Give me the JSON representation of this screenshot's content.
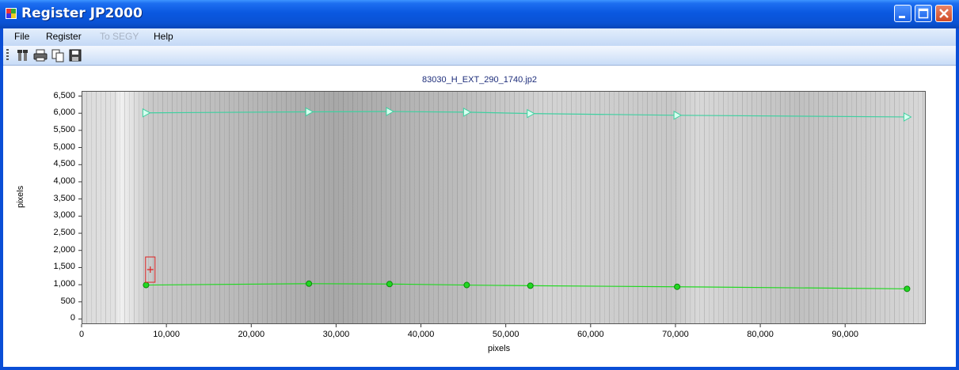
{
  "window": {
    "title": "Register JP2000",
    "buttons": [
      "minimize",
      "maximize",
      "close"
    ]
  },
  "menu": {
    "items": [
      {
        "label": "File",
        "enabled": true
      },
      {
        "label": "Register",
        "enabled": true
      },
      {
        "label": "To SEGY",
        "enabled": false
      },
      {
        "label": "Help",
        "enabled": true
      }
    ]
  },
  "toolbar": {
    "tools": [
      "settings-icon",
      "print-icon",
      "copy-icon",
      "save-icon"
    ]
  },
  "chart_data": {
    "type": "scatter",
    "title": "83030_H_EXT_290_1740.jp2",
    "xlabel": "pixels",
    "ylabel": "pixels",
    "xlim": [
      0,
      99500
    ],
    "ylim": [
      -150,
      6650
    ],
    "x_ticks": [
      "0",
      "10,000",
      "20,000",
      "30,000",
      "40,000",
      "50,000",
      "60,000",
      "70,000",
      "80,000",
      "90,000"
    ],
    "x_tick_values": [
      0,
      10000,
      20000,
      30000,
      40000,
      50000,
      60000,
      70000,
      80000,
      90000
    ],
    "y_ticks": [
      "0",
      "500",
      "1,000",
      "1,500",
      "2,000",
      "2,500",
      "3,000",
      "3,500",
      "4,000",
      "4,500",
      "5,000",
      "5,500",
      "6,000",
      "6,500"
    ],
    "y_tick_values": [
      0,
      500,
      1000,
      1500,
      2000,
      2500,
      3000,
      3500,
      4000,
      4500,
      5000,
      5500,
      6000,
      6500
    ],
    "series": [
      {
        "color": "#3fd0a0",
        "marker": "triangle",
        "x": [
          7600,
          26800,
          36300,
          45400,
          52900,
          70200,
          97300
        ],
        "y": [
          6010,
          6040,
          6050,
          6030,
          5990,
          5940,
          5890
        ]
      },
      {
        "color": "#22d822",
        "marker": "circle",
        "x": [
          7600,
          26800,
          36300,
          45400,
          52900,
          70200,
          97300
        ],
        "y": [
          990,
          1030,
          1020,
          990,
          970,
          940,
          880
        ]
      }
    ],
    "marker_box": {
      "x": 8100,
      "y": 1440,
      "color": "#d22"
    }
  }
}
